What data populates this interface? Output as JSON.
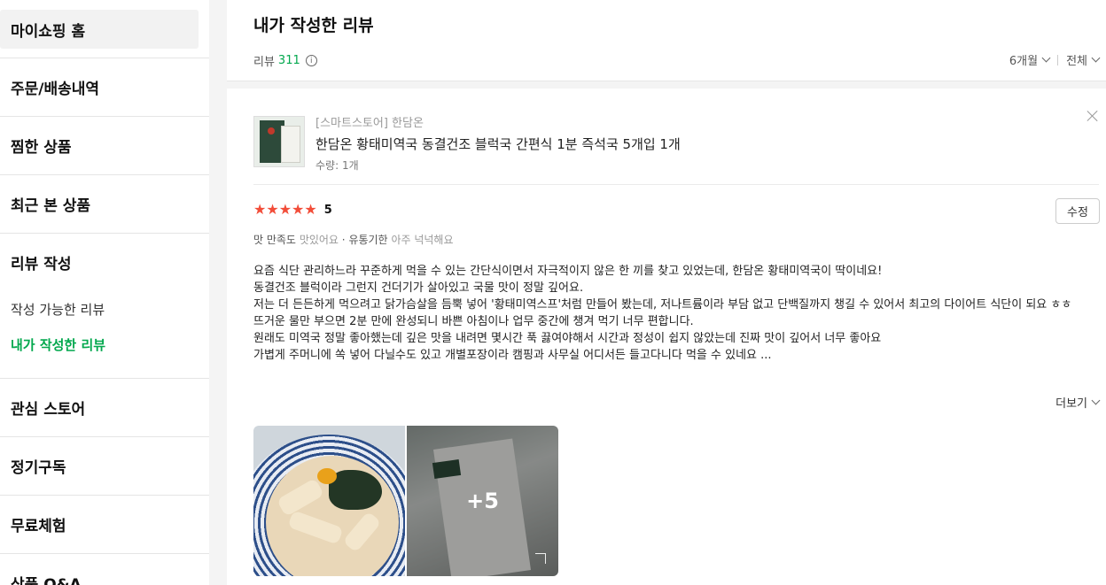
{
  "sidebar": {
    "home": "마이쇼핑 홈",
    "orders": "주문/배송내역",
    "wish": "찜한 상품",
    "recent": "최근 본 상품",
    "review_title": "리뷰 작성",
    "review_available": "작성 가능한 리뷰",
    "review_mine": "내가 작성한 리뷰",
    "stores": "관심 스토어",
    "subscribe": "정기구독",
    "trial": "무료체험",
    "qna": "상품 Q&A"
  },
  "header": {
    "title": "내가 작성한 리뷰",
    "count_label": "리뷰",
    "count": "311",
    "info_icon": "i",
    "period_filter": "6개월",
    "type_filter": "전체"
  },
  "review": {
    "store": "[스마트스토어] 한담온",
    "product": "한담온 황태미역국 동결건조 블럭국 간편식 1분 즉석국 5개입 1개",
    "quantity": "수량: 1개",
    "stars": "★★★★★",
    "score": "5",
    "edit_label": "수정",
    "tags": {
      "taste_label": "맛 만족도",
      "taste_value": "맛있어요",
      "sep": " · ",
      "expiry_label": "유통기한",
      "expiry_value": "아주 넉넉해요"
    },
    "lines": [
      "요즘 식단 관리하느라 꾸준하게 먹을 수 있는 간단식이면서 자극적이지 않은 한 끼를 찾고 있었는데, 한담온 황태미역국이 딱이네요!",
      "동결건조 블럭이라 그런지 건더기가 살아있고 국물 맛이 정말 깊어요.",
      "저는 더 든든하게 먹으려고 닭가슴살을 듬뿍 넣어 '황태미역스프'처럼 만들어 봤는데, 저나트륨이라 부담 없고 단백질까지 챙길 수 있어서 최고의 다이어트 식단이 되요 ㅎㅎ",
      "뜨거운 물만 부으면 2분 만에 완성되니 바쁜 아침이나 업무 중간에 챙겨 먹기 너무 편합니다.",
      "원래도 미역국 정말 좋아했는데 깊은 맛을 내려면 몇시간 푹 끓여야해서 시간과 정성이 쉽지 않았는데 진짜 맛이 깊어서 너무 좋아요",
      "가볍게 주머니에 쏙 넣어 다닐수도 있고 개별포장이라 캠핑과 사무실 어디서든 들고다니다 먹을 수 있네요 ..."
    ],
    "more_label": "더보기",
    "extra_photos": "+5",
    "icons": [
      "close-icon",
      "star-icon",
      "chevron-down-icon",
      "expand-icon",
      "info-icon"
    ],
    "colors": {
      "accent": "#03a84e",
      "star": "#f24d39"
    }
  }
}
